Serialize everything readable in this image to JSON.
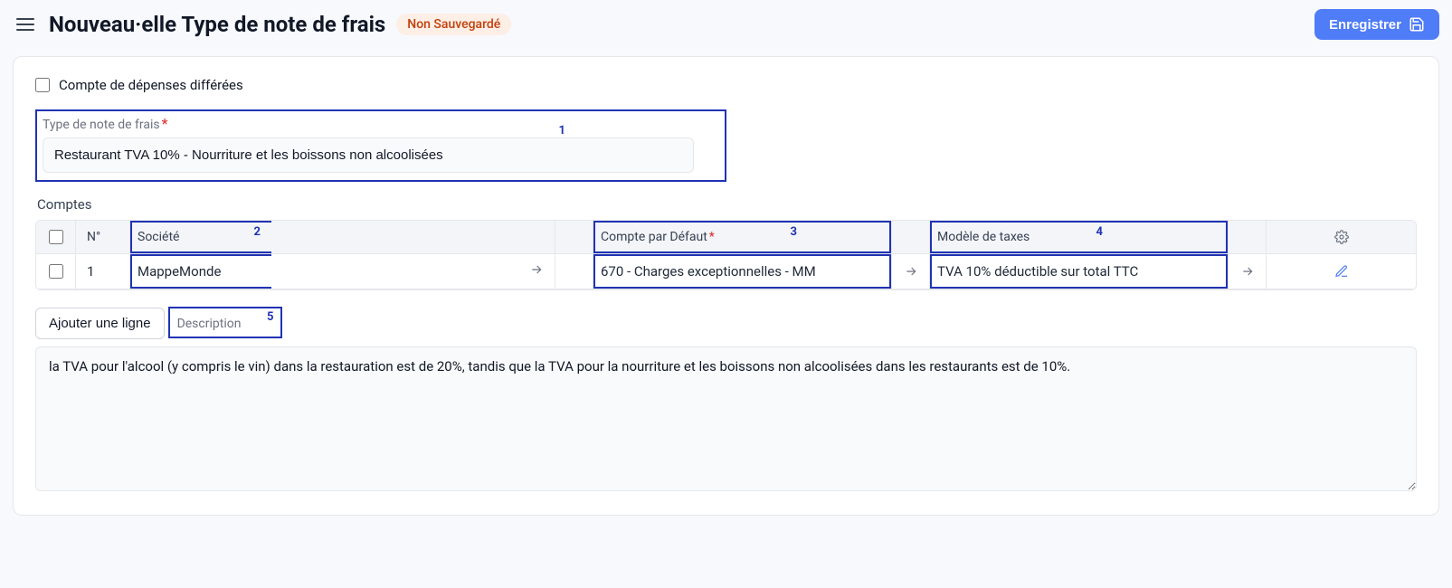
{
  "header": {
    "title": "Nouveau·elle Type de note de frais",
    "badge": "Non Sauvegardé",
    "save_label": "Enregistrer"
  },
  "form": {
    "deferred_label": "Compte de dépenses différées",
    "type_label": "Type de note de frais",
    "type_value": "Restaurant TVA 10% - Nourriture et les boissons non alcoolisées",
    "accounts_label": "Comptes",
    "add_row_label": "Ajouter une ligne",
    "description_label": "Description",
    "description_value": "la TVA pour l'alcool (y compris le vin) dans la restauration est de 20%, tandis que la TVA pour la nourriture et les boissons non alcoolisées dans les restaurants est de 10%."
  },
  "table": {
    "headers": {
      "num": "N°",
      "company": "Société",
      "default_account": "Compte par Défaut",
      "tax_model": "Modèle de taxes"
    },
    "rows": [
      {
        "num": "1",
        "company": "MappeMonde",
        "default_account": "670 - Charges exceptionnelles - MM",
        "tax_model": "TVA 10% déductible sur total TTC"
      }
    ]
  },
  "annotations": {
    "a1": "1",
    "a2": "2",
    "a3": "3",
    "a4": "4",
    "a5": "5"
  }
}
